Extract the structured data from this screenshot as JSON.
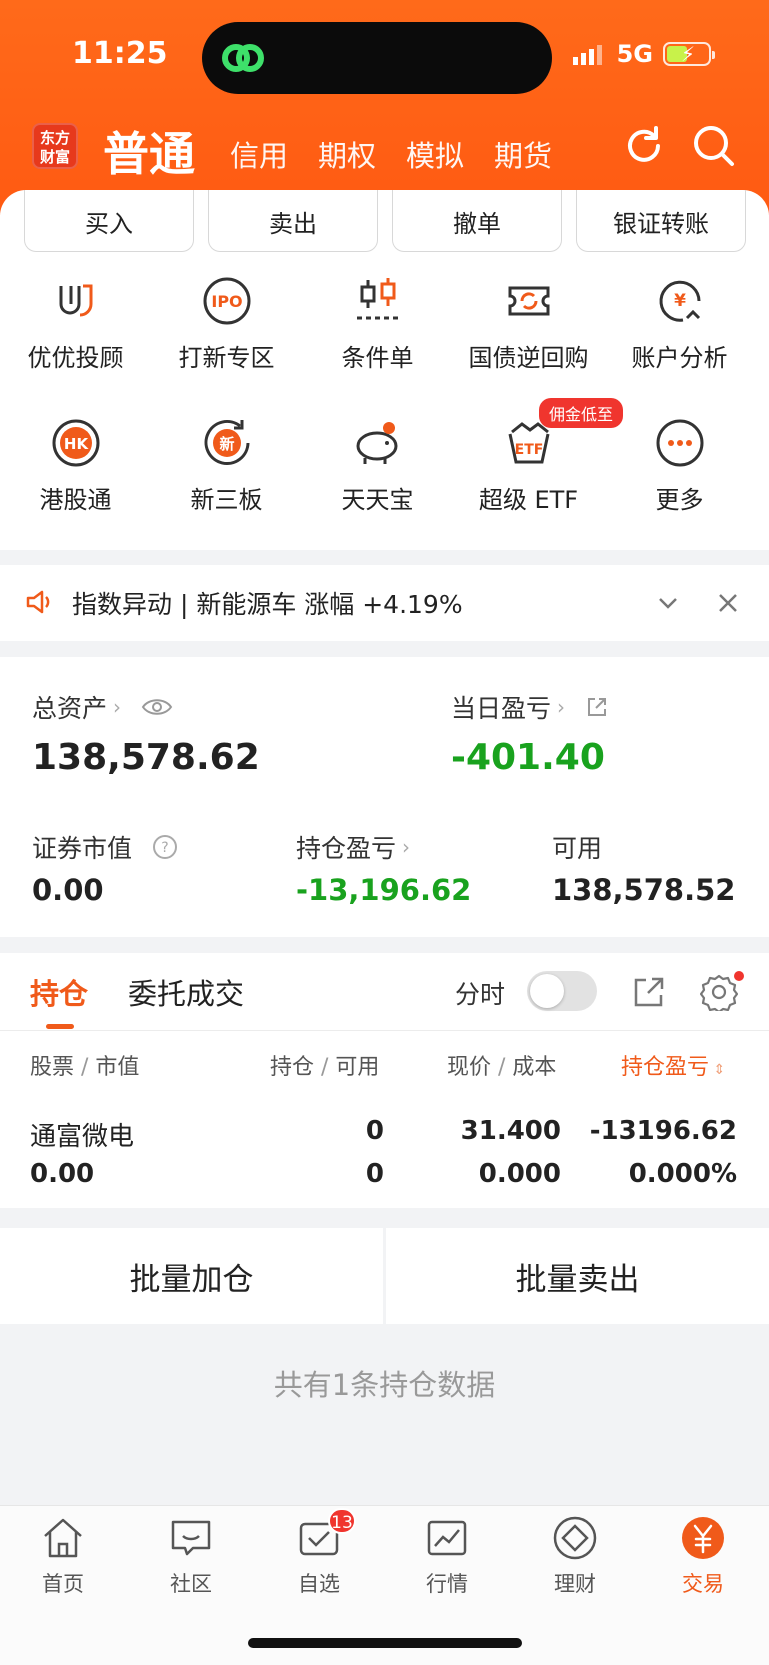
{
  "status": {
    "time": "11:25",
    "network": "5G"
  },
  "header": {
    "logo": "东方财富",
    "active": "普通",
    "tabs": [
      "信用",
      "期权",
      "模拟",
      "期货"
    ]
  },
  "quick_actions": [
    "买入",
    "卖出",
    "撤单",
    "银证转账"
  ],
  "grid": {
    "row1": [
      "优优投顾",
      "打新专区",
      "条件单",
      "国债逆回购",
      "账户分析"
    ],
    "row2": [
      "港股通",
      "新三板",
      "天天宝",
      "超级 ETF",
      "更多"
    ],
    "etf_pill": "佣金低至",
    "ipo_icon_text": "IPO",
    "hk_icon_text": "HK",
    "xin_icon_text": "新",
    "etf_icon_text": "ETF",
    "yen_icon_text": "¥"
  },
  "notice": {
    "text": "指数异动 | 新能源车 涨幅 +4.19%"
  },
  "assets": {
    "total_label": "总资产",
    "total_value": "138,578.62",
    "daily_pl_label": "当日盈亏",
    "daily_pl_value": "-401.40",
    "market_value_label": "证券市值",
    "market_value": "0.00",
    "position_pl_label": "持仓盈亏",
    "position_pl_value": "-13,196.62",
    "available_label": "可用",
    "available_value": "138,578.52"
  },
  "positions": {
    "tab_active": "持仓",
    "tab_other": "委托成交",
    "toggle_label": "分时",
    "toggle_on": false,
    "headers": {
      "stock": "股票",
      "market": "市值",
      "hold": "持仓",
      "avail": "可用",
      "price": "现价",
      "cost": "成本",
      "pl": "持仓盈亏"
    },
    "rows": [
      {
        "name": "通富微电",
        "market_value": "0.00",
        "hold": "0",
        "avail": "0",
        "price": "31.400",
        "cost": "0.000",
        "pl": "-13196.62",
        "pl_pct": "0.000%"
      }
    ]
  },
  "batch": {
    "add": "批量加仓",
    "sell": "批量卖出"
  },
  "count_text": "共有1条持仓数据",
  "tabbar": {
    "items": [
      "首页",
      "社区",
      "自选",
      "行情",
      "理财",
      "交易"
    ],
    "badge": "13",
    "active_index": 5
  },
  "colors": {
    "brand": "#ff5e14",
    "accent": "#f05a1a",
    "loss_green": "#19a21e",
    "badge_red": "#f0352e"
  }
}
